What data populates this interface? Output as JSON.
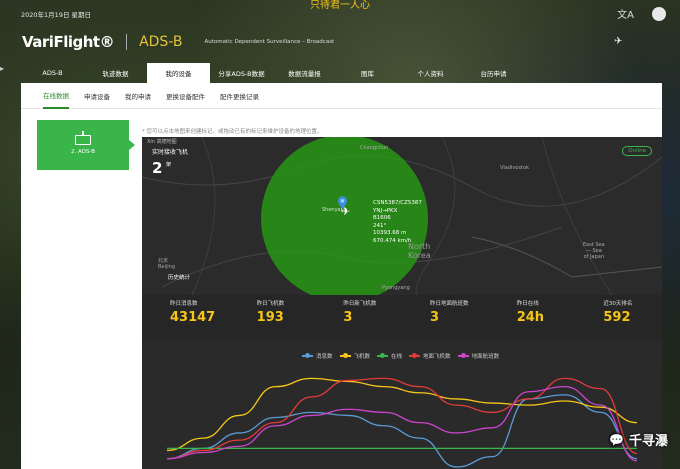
{
  "top_caption": "只待君一人心",
  "header": {
    "date": "2020年1月19日 星期日",
    "brand_logo": "VariFlight®",
    "product": "ADS-B",
    "description": "Automatic Dependent Surveillance – Broadcast",
    "lang_icon_glyph": "文A"
  },
  "nav": {
    "items": [
      {
        "label": "ADS-B"
      },
      {
        "label": "轨迹数据"
      },
      {
        "label": "我的设备"
      },
      {
        "label": "分享ADS-B数据"
      },
      {
        "label": "数据流量报"
      },
      {
        "label": "图库"
      },
      {
        "label": "个人资料"
      },
      {
        "label": "台历申请"
      }
    ],
    "active_index": 2
  },
  "subtabs": {
    "items": [
      {
        "label": "在线数据"
      },
      {
        "label": "申请设备"
      },
      {
        "label": "我的申请"
      },
      {
        "label": "更换设备配件"
      },
      {
        "label": "配件更换记录"
      }
    ],
    "active_index": 0
  },
  "device": {
    "label": "2. ADS-B"
  },
  "hint": "* 您可以点击地图来创建标记，或拖动已有的标记来维护设备的地理位置。",
  "map": {
    "provider": "Xin 高德地图",
    "live_label": "实时接收飞机",
    "live_count": "2",
    "live_unit": "架",
    "online": "Online",
    "history": "历史统计",
    "flight": {
      "line1": "CSN5387/CZ5387",
      "line2": "YNJ→PKX",
      "line3": "B1606",
      "line4": "241°",
      "line5": "10393.68 m",
      "line6": "670.474 km/h"
    },
    "places": {
      "changchun": "Changchun",
      "shenyang": "Shenyang",
      "north_korea": "North\nKorea",
      "east_sea": "East Sea\n— Sea\nof Japan",
      "beijing": "北京\nBeijing",
      "vladivostok": "Vladivostok",
      "pyongyang": "Pyongyang"
    }
  },
  "stats": [
    {
      "label": "昨日消息数",
      "value": "43147"
    },
    {
      "label": "昨日飞机数",
      "value": "193"
    },
    {
      "label": "昨日新飞机数",
      "value": "3"
    },
    {
      "label": "昨日地面航班数",
      "value": "3"
    },
    {
      "label": "昨日在线",
      "value": "24h"
    },
    {
      "label": "近30天排名",
      "value": "592"
    }
  ],
  "watermark": "千寻瀑",
  "chart_data": {
    "type": "line",
    "series": [
      {
        "name": "消息数",
        "color": "#5b9bd5",
        "values": [
          0.1,
          0.2,
          0.35,
          0.5,
          0.55,
          0.52,
          0.42,
          0.3,
          0.02,
          0.12,
          0.68,
          0.72,
          0.55,
          0.1
        ]
      },
      {
        "name": "飞机数",
        "color": "#f5c518",
        "values": [
          0.18,
          0.3,
          0.52,
          0.8,
          0.88,
          0.85,
          0.8,
          0.74,
          0.68,
          0.64,
          0.62,
          0.66,
          0.6,
          0.45
        ]
      },
      {
        "name": "在线",
        "color": "#3ab54a",
        "values": [
          0.2,
          0.2,
          0.2,
          0.2,
          0.2,
          0.2,
          0.2,
          0.2,
          0.2,
          0.2,
          0.2,
          0.2,
          0.2,
          0.2
        ]
      },
      {
        "name": "地面飞机数",
        "color": "#e23a3a",
        "values": [
          0.1,
          0.18,
          0.28,
          0.45,
          0.7,
          0.86,
          0.88,
          0.8,
          0.62,
          0.55,
          0.68,
          0.88,
          0.78,
          0.15
        ]
      },
      {
        "name": "地面航班数",
        "color": "#cc44cc",
        "values": [
          0.1,
          0.16,
          0.22,
          0.42,
          0.52,
          0.58,
          0.55,
          0.45,
          0.35,
          0.4,
          0.75,
          0.8,
          0.62,
          0.08
        ]
      }
    ],
    "ylim": [
      0,
      1
    ]
  }
}
